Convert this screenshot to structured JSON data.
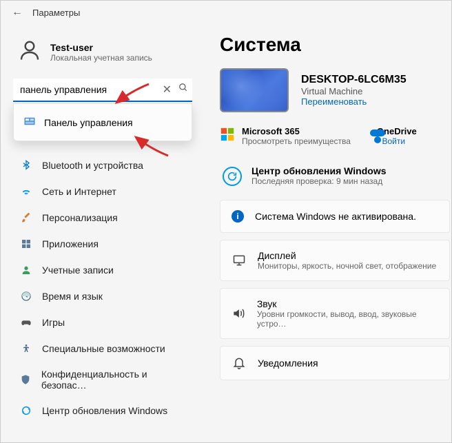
{
  "titlebar": {
    "label": "Параметры"
  },
  "user": {
    "name": "Test-user",
    "subtitle": "Локальная учетная запись"
  },
  "search": {
    "value": "панель управления"
  },
  "search_result": {
    "label": "Панель управления"
  },
  "nav": {
    "bluetooth": "Bluetooth и устройства",
    "network": "Сеть и Интернет",
    "personalization": "Персонализация",
    "apps": "Приложения",
    "accounts": "Учетные записи",
    "time": "Время и язык",
    "games": "Игры",
    "accessibility": "Специальные возможности",
    "privacy": "Конфиденциальность и безопас…",
    "update": "Центр обновления Windows"
  },
  "main": {
    "title": "Система",
    "device": {
      "name": "DESKTOP-6LC6M35",
      "sub": "Virtual Machine",
      "rename": "Переименовать"
    },
    "ms365": {
      "title": "Microsoft 365",
      "sub": "Просмотреть преимущества"
    },
    "onedrive": {
      "title": "OneDrive",
      "link": "Войти"
    },
    "update": {
      "title": "Центр обновления Windows",
      "sub": "Последняя проверка: 9 мин назад"
    },
    "activation": "Система Windows не активирована.",
    "cards": {
      "display": {
        "title": "Дисплей",
        "sub": "Мониторы, яркость, ночной свет, отображение"
      },
      "sound": {
        "title": "Звук",
        "sub": "Уровни громкости, вывод, ввод, звуковые устро…"
      },
      "notifications": {
        "title": "Уведомления",
        "sub": ""
      }
    }
  }
}
